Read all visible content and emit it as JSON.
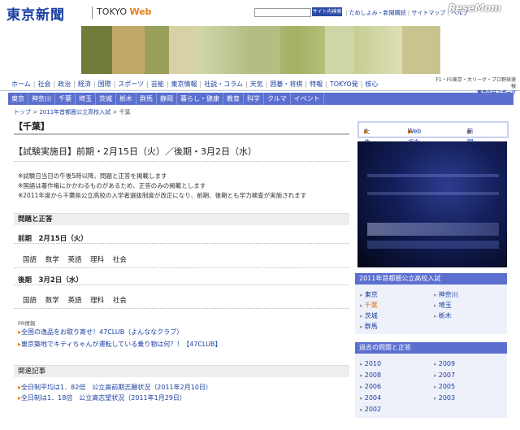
{
  "header": {
    "logo": "東京新聞",
    "site_prefix": "TOKYO",
    "site_suffix": "Web",
    "search_button": "サイト内検索",
    "top_links": [
      "ためしよみ・新聞購読",
      "サイトマップ",
      "ヘルプ"
    ],
    "watermark": "ReseMom"
  },
  "nav_primary": [
    "ホーム",
    "社会",
    "政治",
    "経済",
    "国際",
    "スポーツ",
    "芸能",
    "東京情報",
    "社説・コラム",
    "天気",
    "囲碁・将棋",
    "特報",
    "TOKYO発",
    "核心"
  ],
  "f1_note": {
    "line1": "F1・F0東京・大リーグ・プロ野球速報",
    "line2": "東京中日スポーツ"
  },
  "nav_secondary": [
    "東京",
    "神奈川",
    "千葉",
    "埼玉",
    "茨城",
    "栃木",
    "群馬",
    "静岡",
    "暮らし・健康",
    "教育",
    "科学",
    "クルマ",
    "イベント"
  ],
  "breadcrumb": [
    "トップ",
    "2011年首都圏公立高校入試",
    "千葉"
  ],
  "main": {
    "title": "【千葉】",
    "exam_date": "【試験実施日】前期・2月15日（火）／後期・3月2日（水）",
    "notes": [
      "※試験日当日の午後5時以降、問題と正答を掲載します",
      "※国語は著作権にかかわるものがあるため、正答のみの掲載とします",
      "※2011年度から千葉県公立高校の入学者選抜制度が改正になり、前期、後期とも学力検査が実施されます"
    ],
    "qa_heading": "問題と正答",
    "zenki_label": "前期　2月15日（火）",
    "zenki_subjects": [
      "国語",
      "数学",
      "英語",
      "理科",
      "社会"
    ],
    "kouki_label": "後期　3月2日（水）",
    "kouki_subjects": [
      "国語",
      "数学",
      "英語",
      "理科",
      "社会"
    ],
    "pr_label": "PR情報",
    "pr_links": [
      "全国の逸品をお取り寄せ！47CLUB（よんななクラブ）",
      "東京築地でキティちゃんが運転している乗り物は何？！【47CLUB】"
    ],
    "related_heading": "関連記事",
    "related_links": [
      "全日制平均は1．82倍　公立高前期志願状況（2011年2月10日）",
      "全日制は1．18倍　公立高志望状況（2011年1月29日）"
    ]
  },
  "sidebar": {
    "buttons": [
      "ためしよみ",
      "Webでためしよみ",
      "新聞購読"
    ],
    "exam_panel": {
      "heading": "2011年首都圏公立高校入試",
      "left": [
        "東京",
        "千葉",
        "茨城",
        "群馬"
      ],
      "right": [
        "神奈川",
        "埼玉",
        "栃木"
      ]
    },
    "past_panel": {
      "heading": "過去の問題と正答",
      "left": [
        "2010",
        "2008",
        "2006",
        "2004",
        "2002"
      ],
      "right": [
        "2009",
        "2007",
        "2005",
        "2003"
      ]
    }
  },
  "colors": {
    "accent": "#1a3fa0",
    "nav_bar": "#5b6fcf",
    "highlight": "#e07a1a"
  }
}
